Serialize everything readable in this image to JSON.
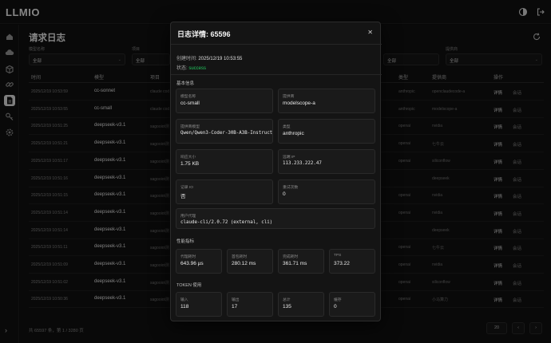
{
  "app": {
    "logo": "LLMIO"
  },
  "page": {
    "title": "请求日志"
  },
  "filters": [
    {
      "label": "模型名称",
      "value": "全部"
    },
    {
      "label": "项目",
      "value": "全部"
    },
    {
      "label": "",
      "value": "全部"
    },
    {
      "label": "提供商",
      "value": "全部"
    }
  ],
  "table": {
    "headers": [
      "时间",
      "模型",
      "项目",
      "类型",
      "提供商",
      "操作"
    ],
    "rows": [
      {
        "time": "2025/12/19 10:53:59",
        "model": "cc-sonnet",
        "project": "claude cod",
        "type": "anthropic",
        "provider": "openclaudecode-a",
        "detail": "详情",
        "chat": "会话"
      },
      {
        "time": "2025/12/19 10:53:55",
        "model": "cc-small",
        "project": "claude cod",
        "type": "anthropic",
        "provider": "modelscope-a",
        "detail": "详情",
        "chat": "会话"
      },
      {
        "time": "2025/12/19 10:51:25",
        "model": "deepseek-v3.1",
        "project": "sagooiot测",
        "type": "openai",
        "provider": "nvidia",
        "detail": "详情",
        "chat": "会话"
      },
      {
        "time": "2025/12/19 10:51:21",
        "model": "deepseek-v3.1",
        "project": "sagooiot测",
        "type": "openai",
        "provider": "七牛云",
        "detail": "详情",
        "chat": "会话"
      },
      {
        "time": "2025/12/19 10:51:17",
        "model": "deepseek-v3.1",
        "project": "sagooiot测",
        "type": "openai",
        "provider": "siliconflow",
        "detail": "详情",
        "chat": "会话"
      },
      {
        "time": "2025/12/19 10:51:16",
        "model": "deepseek-v3.1",
        "project": "sagooiot测",
        "type": "",
        "provider": "deepseek",
        "detail": "详情",
        "chat": "会话"
      },
      {
        "time": "2025/12/19 10:51:15",
        "model": "deepseek-v3.1",
        "project": "sagooiot测",
        "type": "openai",
        "provider": "nvidia",
        "detail": "详情",
        "chat": "会话"
      },
      {
        "time": "2025/12/19 10:51:14",
        "model": "deepseek-v3.1",
        "project": "sagooiot测",
        "type": "openai",
        "provider": "nvidia",
        "detail": "详情",
        "chat": "会话"
      },
      {
        "time": "2025/12/19 10:51:14",
        "model": "deepseek-v3.1",
        "project": "sagooiot测",
        "type": "",
        "provider": "deepseek",
        "detail": "详情",
        "chat": "会话"
      },
      {
        "time": "2025/12/19 10:51:11",
        "model": "deepseek-v3.1",
        "project": "sagooiot测",
        "type": "openai",
        "provider": "七牛云",
        "detail": "详情",
        "chat": "会话"
      },
      {
        "time": "2025/12/19 10:51:09",
        "model": "deepseek-v3.1",
        "project": "sagooiot测",
        "type": "openai",
        "provider": "nvidia",
        "detail": "详情",
        "chat": "会话"
      },
      {
        "time": "2025/12/19 10:51:02",
        "model": "deepseek-v3.1",
        "project": "sagooiot测",
        "type": "openai",
        "provider": "siliconflow",
        "detail": "详情",
        "chat": "会话"
      },
      {
        "time": "2025/12/19 10:50:36",
        "model": "deepseek-v3.1",
        "project": "sagooiot测",
        "type": "openai",
        "provider": "小马算力",
        "detail": "详情",
        "chat": "会话"
      }
    ]
  },
  "footer": {
    "summary": "共 65597 条，第 1 / 3280 页",
    "page_size": "20"
  },
  "modal": {
    "title": "日志详情: 65596",
    "created_label": "创建时间:",
    "created_value": "2025/12/19 10:53:55",
    "status_label": "状态:",
    "status_value": "success",
    "basic_section": "基本信息",
    "basic": [
      {
        "label": "模型名称",
        "value": "cc-small"
      },
      {
        "label": "提供商",
        "value": "modelscope-a"
      },
      {
        "label": "提供商模型",
        "value": "Qwen/Qwen3-Coder-30B-A3B-Instruct"
      },
      {
        "label": "类型",
        "value": "anthropic"
      },
      {
        "label": "响应大小",
        "value": "1.75 KB"
      },
      {
        "label": "远端 IP",
        "value": "113.233.222.47"
      },
      {
        "label": "记录 IO",
        "value": "否"
      },
      {
        "label": "重试次数",
        "value": "0"
      }
    ],
    "user_agent": {
      "label": "用户代理",
      "value": "claude-cli/2.0.72 (external, cli)"
    },
    "perf_section": "性能指标",
    "perf": [
      {
        "label": "代理耗时",
        "value": "643.96 µs"
      },
      {
        "label": "首包耗时",
        "value": "280.12 ms"
      },
      {
        "label": "完成耗时",
        "value": "361.71 ms"
      },
      {
        "label": "TPS",
        "value": "373.22"
      }
    ],
    "token_section": "TOKEN 使用",
    "tokens": [
      {
        "label": "输入",
        "value": "118"
      },
      {
        "label": "输出",
        "value": "17"
      },
      {
        "label": "总计",
        "value": "135"
      },
      {
        "label": "缓存",
        "value": "0"
      }
    ]
  },
  "colors": {
    "accent": "#22c55e",
    "bg": "#0d0d0d",
    "panel": "#141414"
  },
  "icons": [
    "home-icon",
    "cloud-icon",
    "box-icon",
    "link-icon",
    "log-icon",
    "key-icon",
    "settings-icon",
    "theme-icon",
    "logout-icon",
    "refresh-icon",
    "close-icon"
  ]
}
